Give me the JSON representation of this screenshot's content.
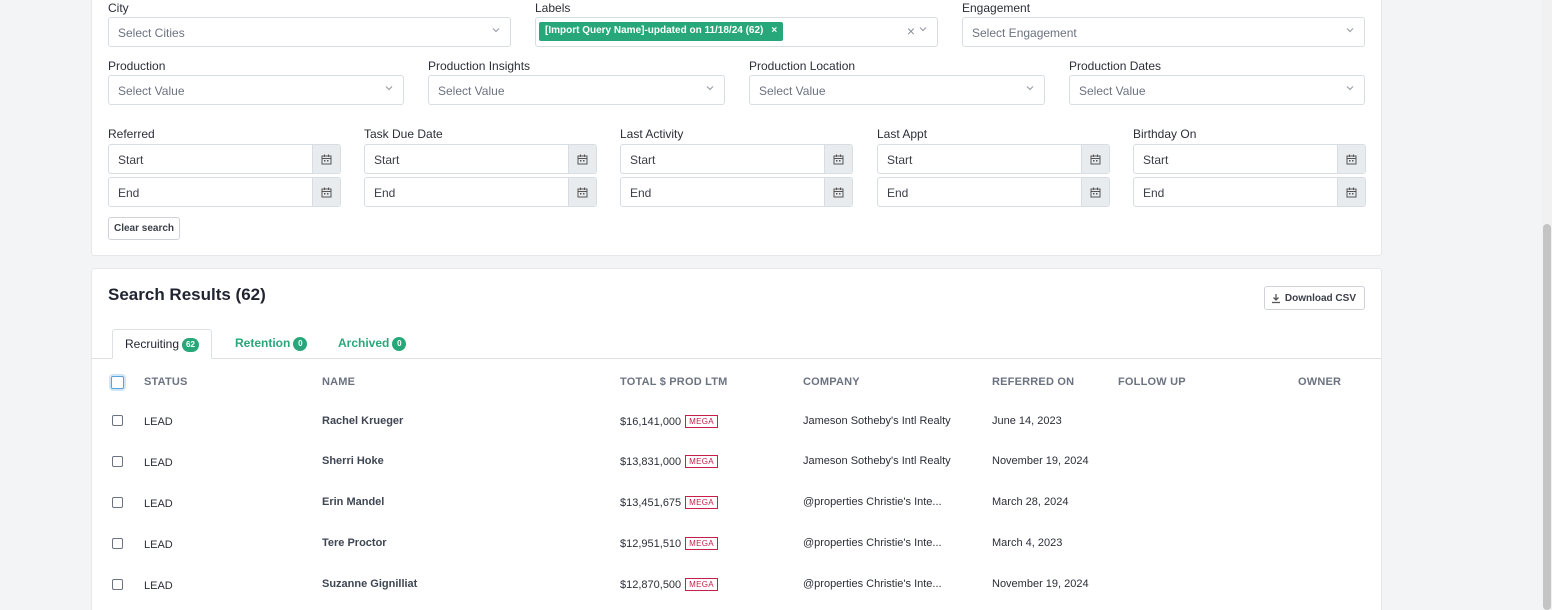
{
  "filters": {
    "row1": [
      {
        "label": "City",
        "placeholder": "Select Cities"
      },
      {
        "label": "Labels",
        "tag": "[Import Query Name]-updated on 11/18/24 (62)"
      },
      {
        "label": "Engagement",
        "placeholder": "Select Engagement"
      }
    ],
    "row2": [
      {
        "label": "Production",
        "placeholder": "Select Value"
      },
      {
        "label": "Production Insights",
        "placeholder": "Select Value"
      },
      {
        "label": "Production Location",
        "placeholder": "Select Value"
      },
      {
        "label": "Production Dates",
        "placeholder": "Select Value"
      }
    ],
    "dates": [
      {
        "label": "Referred",
        "start": "Start",
        "end": "End"
      },
      {
        "label": "Task Due Date",
        "start": "Start",
        "end": "End"
      },
      {
        "label": "Last Activity",
        "start": "Start",
        "end": "End"
      },
      {
        "label": "Last Appt",
        "start": "Start",
        "end": "End"
      },
      {
        "label": "Birthday On",
        "start": "Start",
        "end": "End"
      }
    ],
    "clear_label": "Clear search"
  },
  "results": {
    "title": "Search Results (62)",
    "download_label": "Download CSV",
    "tabs": [
      {
        "label": "Recruiting",
        "count": "62"
      },
      {
        "label": "Retention",
        "count": "0"
      },
      {
        "label": "Archived",
        "count": "0"
      }
    ],
    "columns": [
      "STATUS",
      "NAME",
      "TOTAL $ PROD LTM",
      "COMPANY",
      "REFERRED ON",
      "FOLLOW UP",
      "OWNER"
    ],
    "rows": [
      {
        "status": "LEAD",
        "name": "Rachel Krueger",
        "prod": "$16,141,000",
        "badge": "MEGA",
        "company": "Jameson Sotheby's Intl Realty",
        "referred": "June 14, 2023"
      },
      {
        "status": "LEAD",
        "name": "Sherri Hoke",
        "prod": "$13,831,000",
        "badge": "MEGA",
        "company": "Jameson Sotheby's Intl Realty",
        "referred": "November 19, 2024"
      },
      {
        "status": "LEAD",
        "name": "Erin Mandel",
        "prod": "$13,451,675",
        "badge": "MEGA",
        "company": "@properties Christie's Inte...",
        "referred": "March 28, 2024"
      },
      {
        "status": "LEAD",
        "name": "Tere Proctor",
        "prod": "$12,951,510",
        "badge": "MEGA",
        "company": "@properties Christie's Inte...",
        "referred": "March 4, 2023"
      },
      {
        "status": "LEAD",
        "name": "Suzanne Gignilliat",
        "prod": "$12,870,500",
        "badge": "MEGA",
        "company": "@properties Christie's Inte...",
        "referred": "November 19, 2024"
      }
    ]
  }
}
